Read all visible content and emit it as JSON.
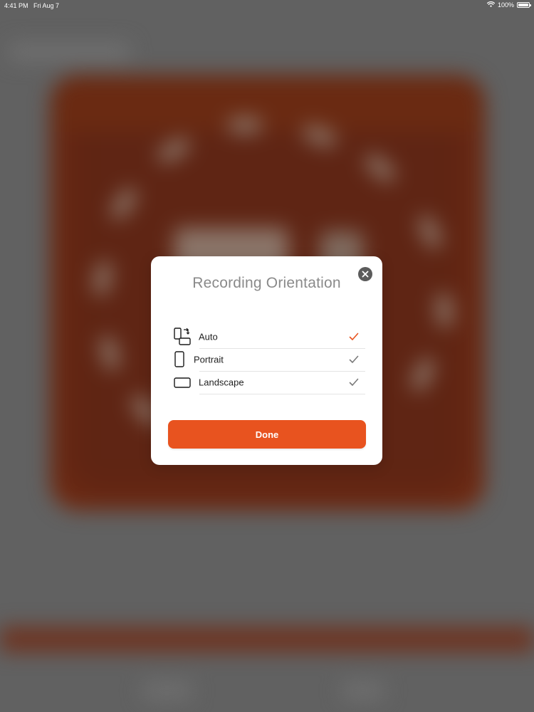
{
  "status_bar": {
    "time": "4:41 PM",
    "date": "Fri Aug 7",
    "battery_text": "100%",
    "battery_level": 1.0
  },
  "modal": {
    "title": "Recording Orientation",
    "options": [
      {
        "label": "Auto",
        "icon": "auto-rotate-icon",
        "check_color": "#e8531f"
      },
      {
        "label": "Portrait",
        "icon": "portrait-icon",
        "check_color": "#7a7a7a"
      },
      {
        "label": "Landscape",
        "icon": "landscape-icon",
        "check_color": "#7a7a7a"
      }
    ],
    "done_label": "Done"
  },
  "colors": {
    "accent": "#e8531f",
    "overlay": "#616161",
    "title_gray": "#8a8a8a",
    "close_button": "#5b5b5b"
  }
}
